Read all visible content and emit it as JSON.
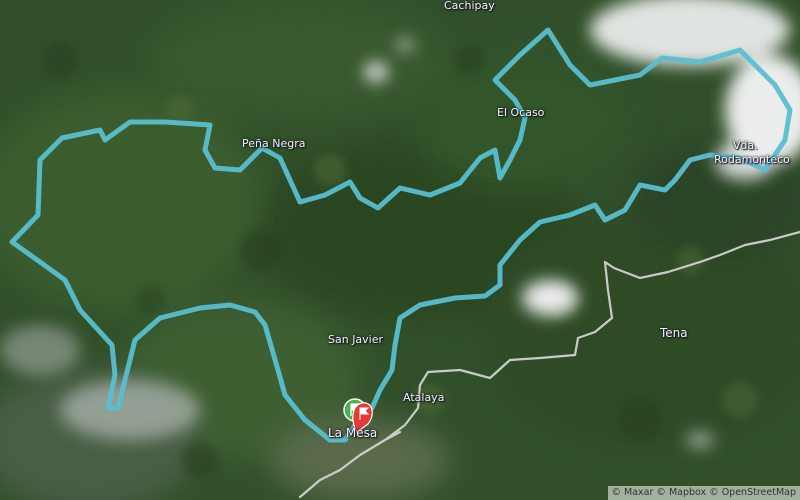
{
  "map": {
    "imagery": "satellite",
    "route_color": "#5bc2d3",
    "road_color": "#d9d9d9",
    "place_labels": [
      "Cachipay",
      "El Ocaso",
      "Peña Negra",
      "Vda.",
      "Rodamonteco",
      "San Javier",
      "Atalaya",
      "La Mesa",
      "Tena"
    ],
    "start_marker_icon": "flag-icon",
    "start_marker_color": "#4caf50",
    "end_marker_icon": "flag-icon",
    "end_marker_color": "#e53935",
    "attribution": "© Maxar © Mapbox © OpenStreetMap"
  }
}
